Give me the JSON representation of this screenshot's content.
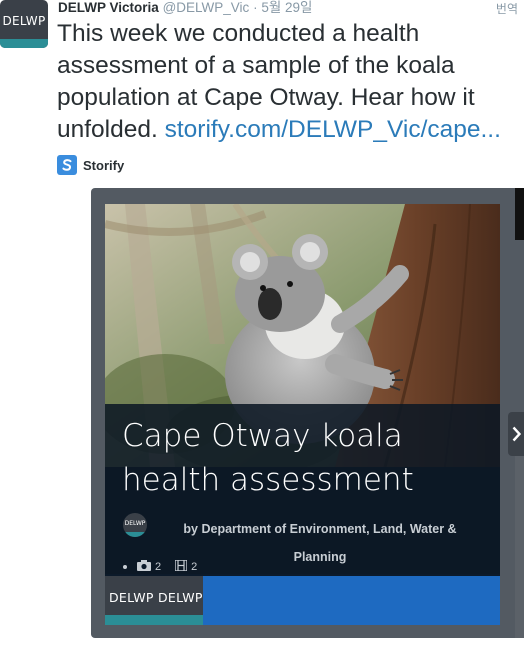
{
  "tweet": {
    "avatar_label": "DELWP",
    "author_name": "DELWP Victoria",
    "handle": "@DELWP_Vic",
    "separator": "·",
    "time": "5월 29일",
    "translate_label": "번역",
    "text_lines": [
      "This week we conducted a health",
      "assessment of a sample of the koala",
      "population at Cape Otway. Hear how it"
    ],
    "text_last_prefix": "unfolded. ",
    "link_text": "storify.com/DELWP_Vic/cape..."
  },
  "source": {
    "icon": "storify-icon",
    "name": "Storify"
  },
  "card": {
    "image": "koala-photo",
    "title_line1": "Cape Otway koala",
    "title_line2": "health assessment",
    "author_avatar_label": "DELWP",
    "author_line1": "by Department of Environment, Land, Water &",
    "author_line2": "Planning",
    "photo_count": "2",
    "video_count": "2",
    "footer_thumb_label": "DELWP  DELWP"
  },
  "colors": {
    "link": "#2b7bb9",
    "storify_blue": "#3a8dde",
    "card_frame": "#535a62",
    "footer_blue": "#1e6ac1",
    "delwp_teal": "#2b8e96"
  }
}
